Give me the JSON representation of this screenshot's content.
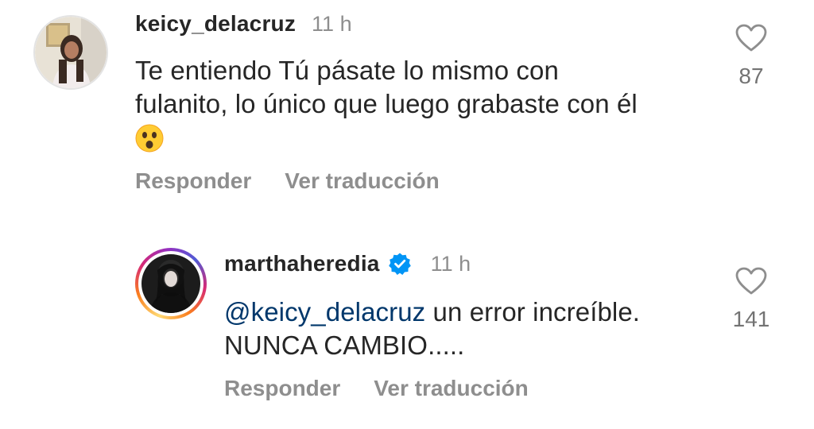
{
  "comments": [
    {
      "username": "keicy_delacruz",
      "timestamp": "11 h",
      "text_line1": "Te entiendo Tú pásate lo mismo con",
      "text_line2": "fulanito, lo único que luego grabaste con él",
      "emoji_icon": "astonished-face-emoji",
      "reply_label": "Responder",
      "translate_label": "Ver traducción",
      "likes": "87"
    },
    {
      "username": "marthaheredia",
      "verified": true,
      "timestamp": "11 h",
      "mention": "@keicy_delacruz",
      "text_rest": " un error increíble.",
      "text_line2": "NUNCA CAMBIO.....",
      "reply_label": "Responder",
      "translate_label": "Ver traducción",
      "likes": "141"
    }
  ],
  "colors": {
    "text": "#262626",
    "muted": "#8e8e8e",
    "mention": "#00376b",
    "verified": "#0095f6"
  }
}
